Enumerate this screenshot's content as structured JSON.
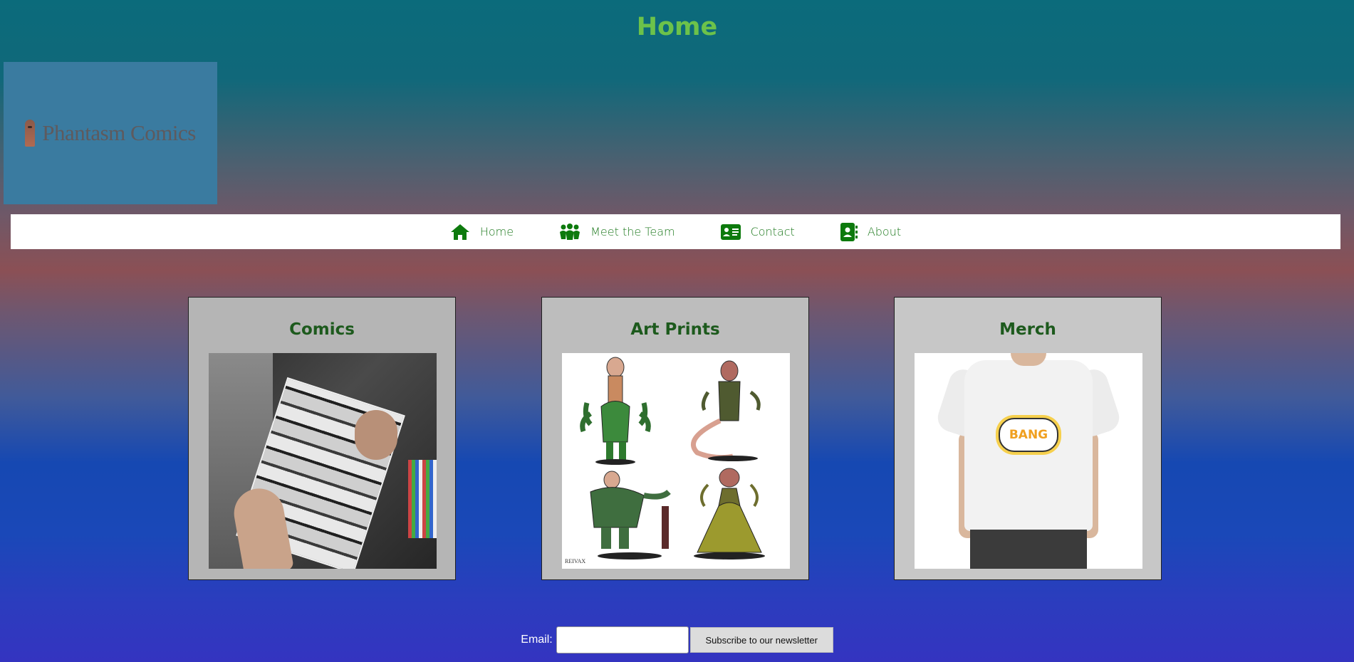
{
  "page": {
    "title": "Home"
  },
  "logo": {
    "text": "Phantasm Comics"
  },
  "nav": {
    "items": [
      {
        "label": "Home",
        "icon": "home-icon"
      },
      {
        "label": "Meet the Team",
        "icon": "users-icon"
      },
      {
        "label": "Contact",
        "icon": "contact-card-icon"
      },
      {
        "label": "About",
        "icon": "address-book-icon"
      }
    ]
  },
  "cards": [
    {
      "title": "Comics",
      "image": "comic-book-photo"
    },
    {
      "title": "Art Prints",
      "image": "art-prints-illustration"
    },
    {
      "title": "Merch",
      "image": "tshirt-photo"
    }
  ],
  "merch_graphic": {
    "text": "BANG"
  },
  "art_signature": {
    "text": "REIVAX"
  },
  "newsletter": {
    "email_label": "Email:",
    "email_value": "",
    "subscribe_label": "Subscribe to our newsletter"
  },
  "colors": {
    "title": "#6cc24a",
    "nav_text": "#1f7a1f",
    "card_title": "#1d5a1d",
    "logo_bg": "#3a7ba0"
  }
}
